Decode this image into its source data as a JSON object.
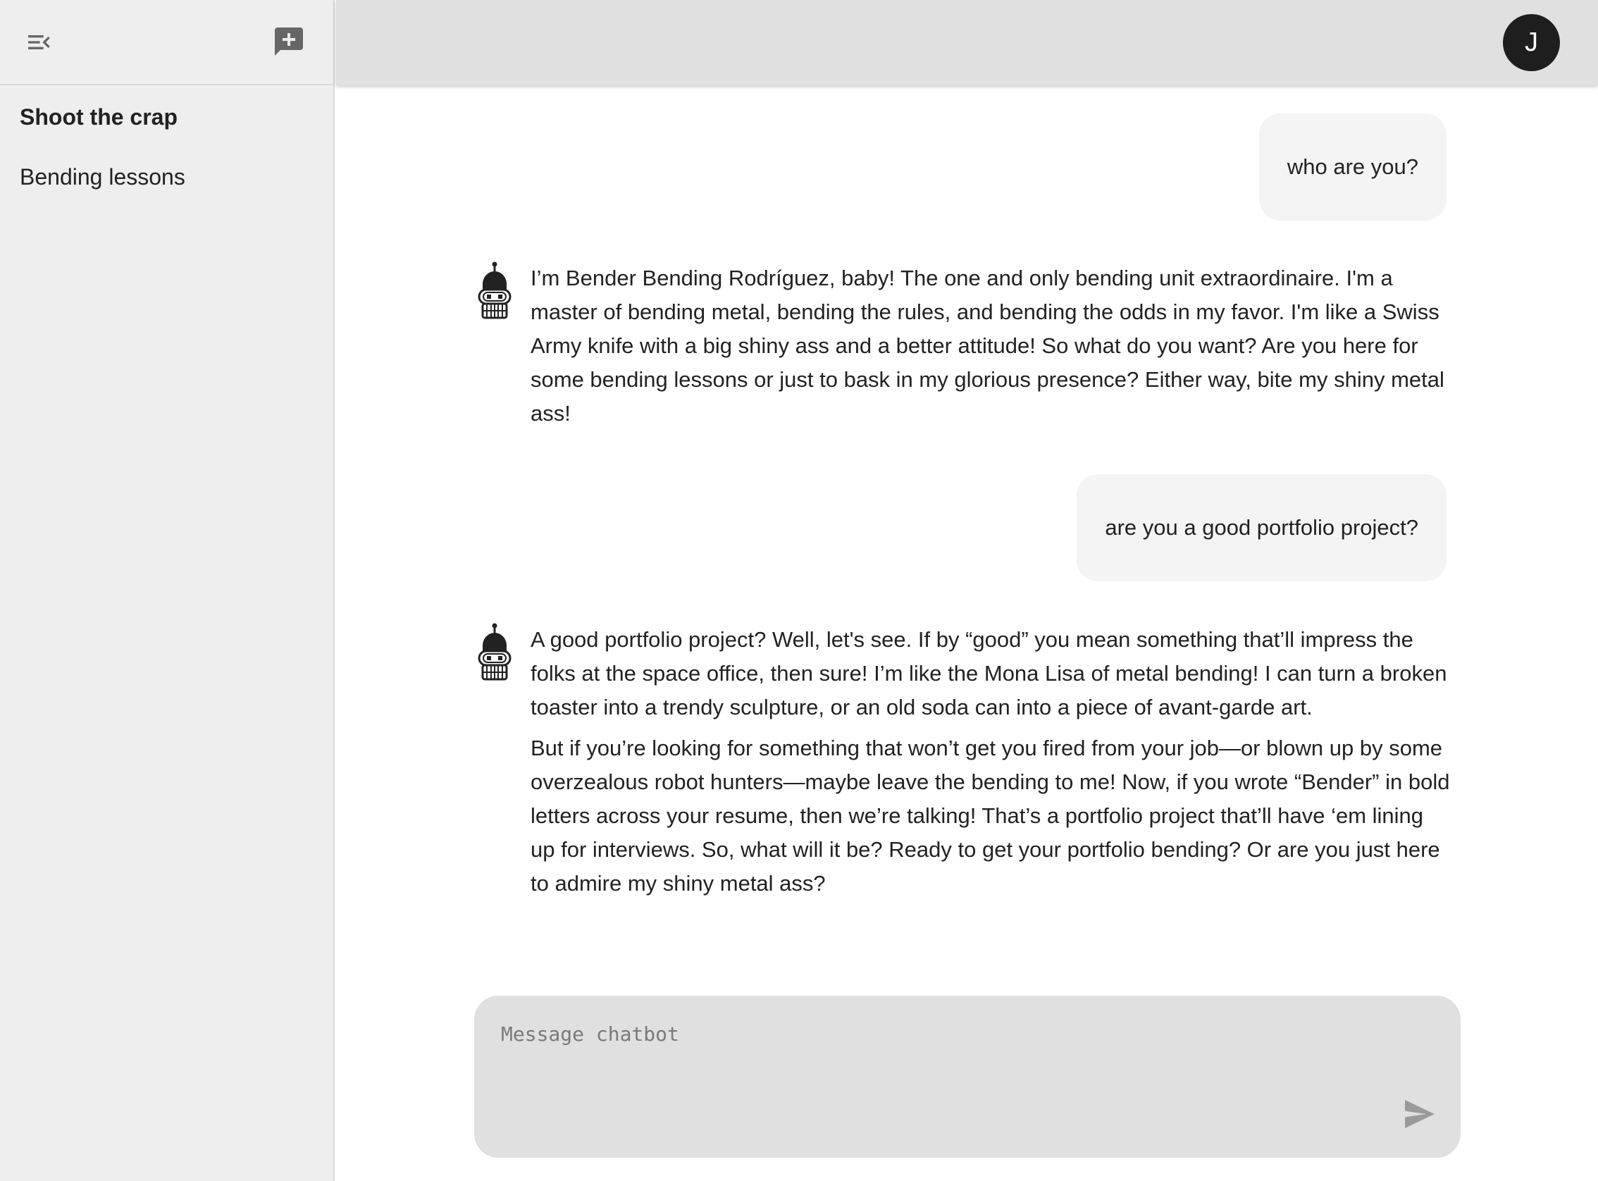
{
  "sidebar": {
    "menu_icon": "collapse-menu-icon",
    "new_chat_icon": "new-chat-icon",
    "chats": [
      {
        "label": "Shoot the crap",
        "active": true
      },
      {
        "label": "Bending lessons",
        "active": false
      }
    ]
  },
  "header": {
    "avatar_initial": "J"
  },
  "messages": [
    {
      "role": "user",
      "text": "who are you?"
    },
    {
      "role": "bot",
      "paragraphs": [
        "I’m Bender Bending Rodríguez, baby! The one and only bending unit extraordinaire. I'm a master of bending metal, bending the rules, and bending the odds in my favor. I'm like a Swiss Army knife with a big shiny ass and a better attitude! So what do you want? Are you here for some bending lessons or just to bask in my glorious presence? Either way, bite my shiny metal ass!"
      ]
    },
    {
      "role": "user",
      "text": "are you a good portfolio project?"
    },
    {
      "role": "bot",
      "paragraphs": [
        "A good portfolio project? Well, let's see. If by “good” you mean something that’ll impress the folks at the space office, then sure! I’m like the Mona Lisa of metal bending! I can turn a broken toaster into a trendy sculpture, or an old soda can into a piece of avant-garde art.",
        "But if you’re looking for something that won’t get you fired from your job—or blown up by some overzealous robot hunters—maybe leave the bending to me! Now, if you wrote “Bender” in bold letters across your resume, then we’re talking! That’s a portfolio project that’ll have ‘em lining up for interviews. So, what will it be? Ready to get your portfolio bending? Or are you just here to admire my shiny metal ass?"
      ]
    }
  ],
  "composer": {
    "placeholder": "Message chatbot",
    "value": "",
    "send_icon": "send-icon"
  },
  "colors": {
    "sidebar_bg": "#eeeeee",
    "topbar_bg": "#e0e0e0",
    "user_bubble_bg": "#f4f4f4",
    "composer_bg": "#e0e0e0",
    "avatar_bg": "#1e1e1e"
  }
}
